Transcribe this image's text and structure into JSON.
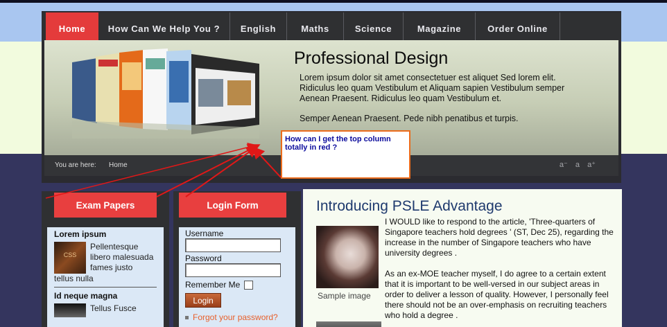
{
  "nav": {
    "items": [
      {
        "label": "Home",
        "active": true
      },
      {
        "label": "How Can We Help You ?"
      },
      {
        "label": "English"
      },
      {
        "label": "Maths"
      },
      {
        "label": "Science"
      },
      {
        "label": "Magazine"
      },
      {
        "label": "Order Online"
      }
    ]
  },
  "hero": {
    "title": "Professional Design",
    "para1": "Lorem ipsum dolor sit amet consectetuer est aliquet Sed lorem elit. Ridiculus leo quam Vestibulum et Aliquam sapien Vestibulum semper Aenean Praesent. Ridiculus leo quam Vestibulum et.",
    "para2": "Semper Aenean Praesent. Pede nibh penatibus et turpis."
  },
  "breadcrumb": {
    "label": "You are here:",
    "home": "Home",
    "font_sizes": [
      "a⁻",
      "a",
      "a⁺"
    ]
  },
  "annotation": {
    "callout_text": "How can I get the top column totally in red ?",
    "border_color": "#ec6c1c",
    "arrow_color": "#e01818"
  },
  "exam_module": {
    "title": "Exam Papers",
    "items": [
      {
        "heading": "Lorem ipsum",
        "text": "Pellentesque libero malesuada fames justo",
        "tail": "tellus nulla"
      },
      {
        "heading": "Id neque magna",
        "text": "Tellus Fusce"
      }
    ]
  },
  "login_module": {
    "title": "Login Form",
    "username_label": "Username",
    "password_label": "Password",
    "remember_label": "Remember Me",
    "login_button": "Login",
    "forgot_link": "Forgot your password?"
  },
  "article": {
    "title": "Introducing PSLE Advantage",
    "image_caption": "Sample image",
    "para1": "I WOULD like to respond to the article, 'Three-quarters of Singapore teachers hold degrees ' (ST, Dec 25), regarding the increase in the number of Singapore teachers who have university degrees .",
    "para2": "As an ex-MOE teacher myself, I do agree to a certain extent that it is important to be well-versed in our subject areas in order to deliver a lesson of quality. However, I personally feel there should not be an over-emphasis on recruiting teachers who hold a degree ."
  },
  "colors": {
    "accent_red": "#e43b3b",
    "nav_bg": "#2f3032",
    "page_bg": "#34355e",
    "sidebar_bg": "#dbe8f6",
    "link_orange": "#e8602c"
  }
}
